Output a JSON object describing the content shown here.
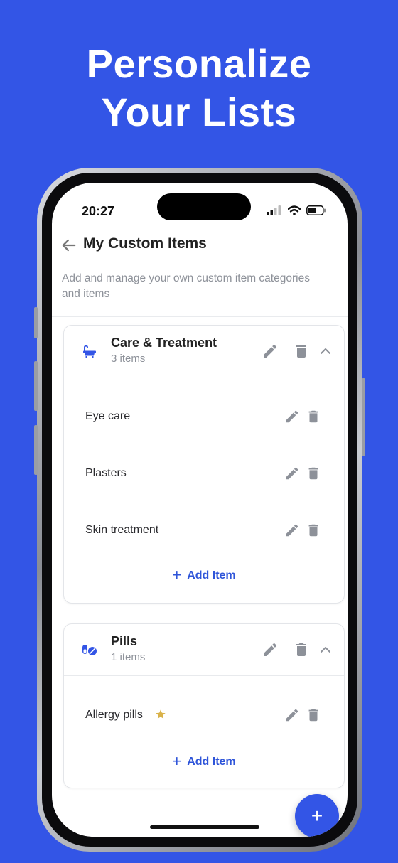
{
  "headline": {
    "line1": "Personalize",
    "line2": "Your Lists"
  },
  "status_bar": {
    "time": "20:27"
  },
  "app_bar": {
    "title": "My Custom Items"
  },
  "subtitle": "Add and manage your own custom item categories and items",
  "categories": [
    {
      "name": "Care & Treatment",
      "count": "3 items",
      "icon": "bathtub-icon",
      "items": [
        {
          "name": "Eye care",
          "favorite": false
        },
        {
          "name": "Plasters",
          "favorite": false
        },
        {
          "name": "Skin treatment",
          "favorite": false
        }
      ],
      "add_label": "Add Item"
    },
    {
      "name": "Pills",
      "count": "1 items",
      "icon": "pills-icon",
      "items": [
        {
          "name": "Allergy pills",
          "favorite": true
        }
      ],
      "add_label": "Add Item"
    }
  ],
  "fab": {
    "icon": "plus-icon",
    "label": "+"
  },
  "colors": {
    "accent": "#3355e6",
    "star": "#d9b24a",
    "icon_gray": "#8d9199"
  }
}
